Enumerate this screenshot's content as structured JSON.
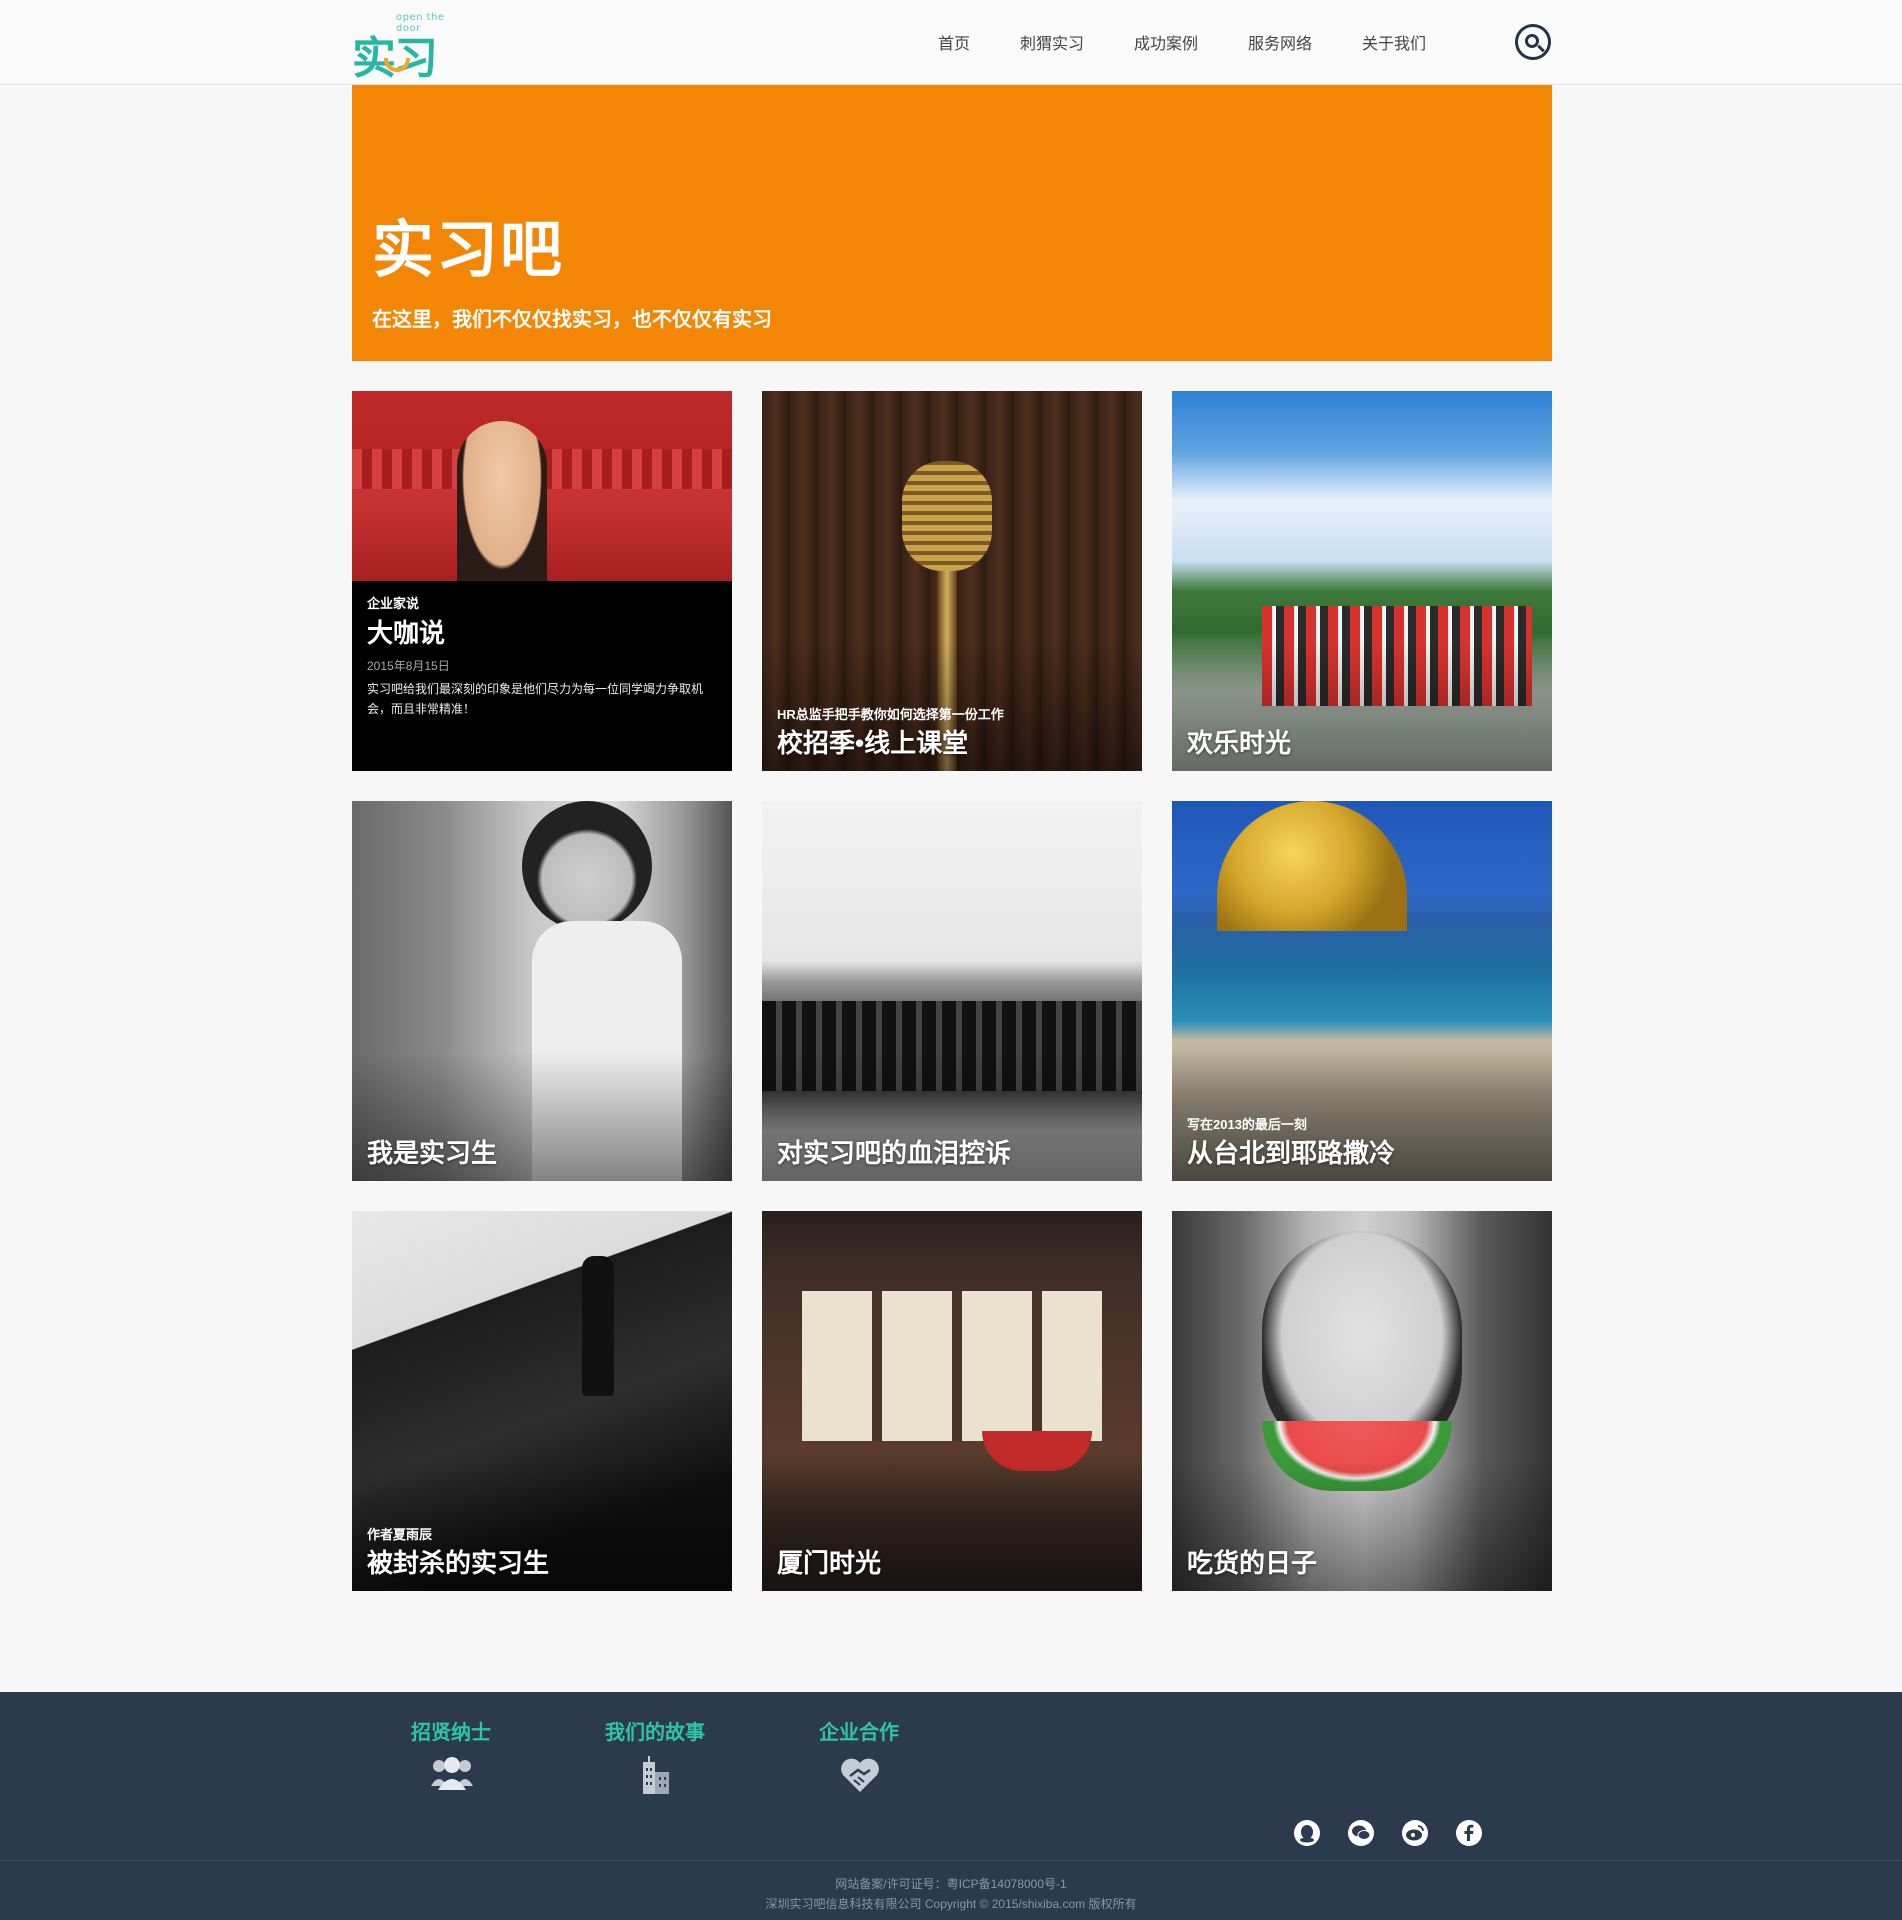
{
  "header": {
    "logo_text": "实习吧",
    "logo_tagline": "open the door",
    "nav": [
      "首页",
      "刺猬实习",
      "成功案例",
      "服务网络",
      "关于我们"
    ]
  },
  "hero": {
    "title": "实习吧",
    "subtitle": "在这里，我们不仅仅找实习，也不仅仅有实习",
    "color": "#f48606"
  },
  "tiles": [
    {
      "kicker": "企业家说",
      "title": "大咖说",
      "date": "2015年8月15日",
      "description": "实习吧给我们最深刻的印象是他们尽力为每一位同学竭力争取机会，而且非常精准！"
    },
    {
      "kicker": "HR总监手把手教你如何选择第一份工作",
      "title": "校招季•线上课堂"
    },
    {
      "title": "欢乐时光"
    },
    {
      "title": "我是实习生"
    },
    {
      "title": "对实习吧的血泪控诉"
    },
    {
      "kicker": "写在2013的最后一刻",
      "title": "从台北到耶路撒冷"
    },
    {
      "kicker": "作者夏雨辰",
      "title": "被封杀的实习生"
    },
    {
      "title": "厦门时光"
    },
    {
      "title": "吃货的日子"
    }
  ],
  "footer": {
    "links": [
      "招贤纳士",
      "我们的故事",
      "企业合作"
    ],
    "icons": [
      "people-icon",
      "building-icon",
      "handshake-icon"
    ],
    "social": [
      "qq-icon",
      "wechat-icon",
      "weibo-icon",
      "facebook-icon"
    ],
    "record": "网站备案/许可证号：粤ICP备14078000号-1",
    "copyright": "深圳实习吧信息科技有限公司 Copyright © 2015/shixiba.com 版权所有",
    "accent": "#2ec4a6",
    "background": "#2b3a4c"
  }
}
